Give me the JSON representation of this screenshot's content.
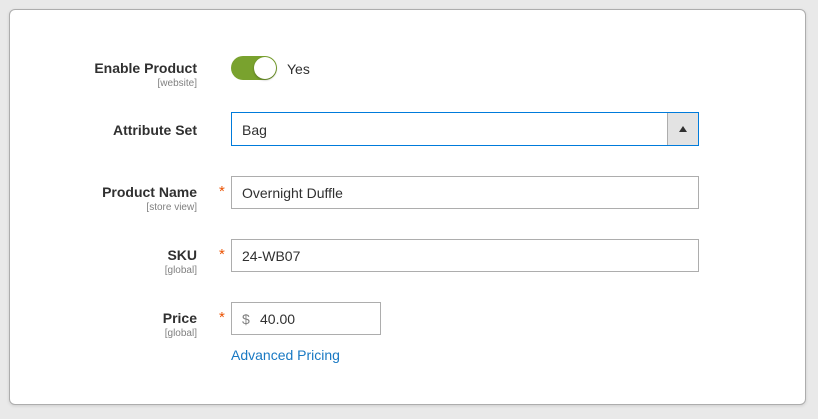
{
  "form": {
    "enable_product": {
      "label": "Enable Product",
      "scope": "[website]",
      "value_text": "Yes",
      "enabled": true
    },
    "attribute_set": {
      "label": "Attribute Set",
      "value": "Bag"
    },
    "product_name": {
      "label": "Product Name",
      "scope": "[store view]",
      "value": "Overnight Duffle",
      "required_mark": "*"
    },
    "sku": {
      "label": "SKU",
      "scope": "[global]",
      "value": "24-WB07",
      "required_mark": "*"
    },
    "price": {
      "label": "Price",
      "scope": "[global]",
      "currency": "$",
      "value": "40.00",
      "required_mark": "*",
      "advanced_link": "Advanced Pricing"
    }
  },
  "colors": {
    "toggle_on": "#79a22e",
    "required": "#eb5202",
    "link": "#1979c3",
    "focus_border": "#007bdb"
  },
  "icons": {
    "select_arrow": "triangle-up-icon"
  }
}
